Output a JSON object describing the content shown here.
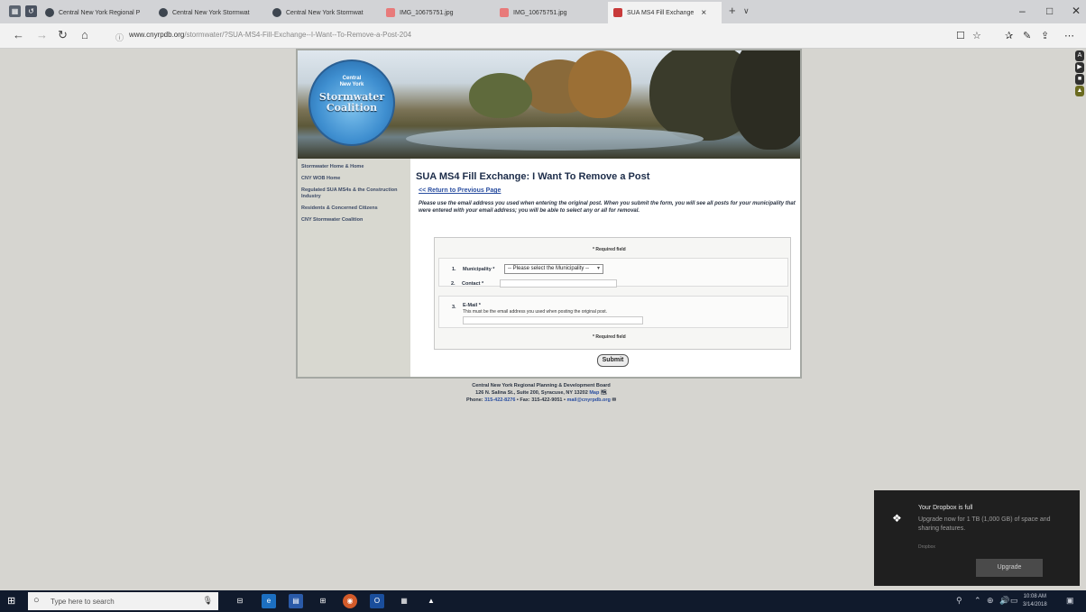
{
  "browser": {
    "tabs": [
      {
        "label": "Central New York Regional P",
        "type": "page"
      },
      {
        "label": "Central New York Stormwat",
        "type": "page"
      },
      {
        "label": "Central New York Stormwat",
        "type": "page"
      },
      {
        "label": "IMG_10675751.jpg",
        "type": "image"
      },
      {
        "label": "IMG_10675751.jpg",
        "type": "image"
      },
      {
        "label": "SUA MS4 Fill Exchange",
        "type": "active"
      }
    ],
    "new_tab": "+",
    "tab_list": "∨",
    "close_tab": "×",
    "window": {
      "minimize": "–",
      "maximize": "□",
      "close": "✕"
    },
    "nav": {
      "back": "←",
      "forward": "→",
      "refresh": "↻",
      "home": "⌂"
    },
    "url_host": "www.cnyrpdb.org",
    "url_path": "/stormwater/?SUA-MS4-Fill-Exchange--I-Want--To-Remove-a-Post-204",
    "toolbar_icons": {
      "reading": "☐",
      "favorite": "☆",
      "favorites": "✰",
      "notes": "✎",
      "share": "⇪",
      "more": "⋯"
    }
  },
  "ext_icons": [
    "A",
    "▶",
    "■",
    "▲"
  ],
  "site": {
    "logo": {
      "top": "Central",
      "mid": "New York",
      "name1": "Stormwater",
      "name2": "Coalition"
    },
    "sidebar": [
      "Stormwater Home & Home",
      "CNY WOB Home",
      "Regulated SUA MS4s & the Construction Industry",
      "Residents & Concerned Citizens",
      "CNY Stormwater Coalition"
    ],
    "page_title": "SUA MS4 Fill Exchange: I Want To Remove a Post",
    "back_link": "<< Return to Previous Page",
    "instructions": "Please use the email address you used when entering the original post. When you submit the form, you will see all posts for your municipality that were entered with your email address; you will be able to select any or all for removal.",
    "form": {
      "required_note": "* Required field",
      "fields": [
        {
          "num": "1.",
          "label": "Municipality *",
          "type": "select",
          "value": "-- Please select the Municipality --"
        },
        {
          "num": "2.",
          "label": "Contact *",
          "type": "text"
        },
        {
          "num": "3.",
          "label": "E-Mail *",
          "type": "text",
          "hint": "This must be the email address you used when posting the original post."
        }
      ],
      "submit_label": "Submit"
    },
    "footer": {
      "line1": "Central New York Regional Planning & Development Board",
      "line2": "126 N. Salina St., Suite 200, Syracuse, NY 13202",
      "map_link": "Map",
      "line3_phone_label": "Phone:",
      "phone": "315-422-8276",
      "fax": "• Fax: 315-422-9051 •",
      "email": "mail@cnyrpdb.org"
    }
  },
  "toast": {
    "title": "Your Dropbox is full",
    "body": "Upgrade now for 1 TB (1,000 GB) of space and sharing features.",
    "app": "Dropbox",
    "button": "Upgrade"
  },
  "taskbar": {
    "start": "⊞",
    "search_placeholder": "Type here to search",
    "search_icon": "○",
    "mic": "🎤",
    "apps": [
      "⊟",
      "e",
      "▤",
      "⊞",
      "◉",
      "O",
      "▦",
      "▲"
    ],
    "tray": [
      "⌃",
      "⊕",
      "🔊",
      "▭"
    ],
    "time": "10:08 AM",
    "date": "3/14/2018",
    "notification": "▣"
  }
}
